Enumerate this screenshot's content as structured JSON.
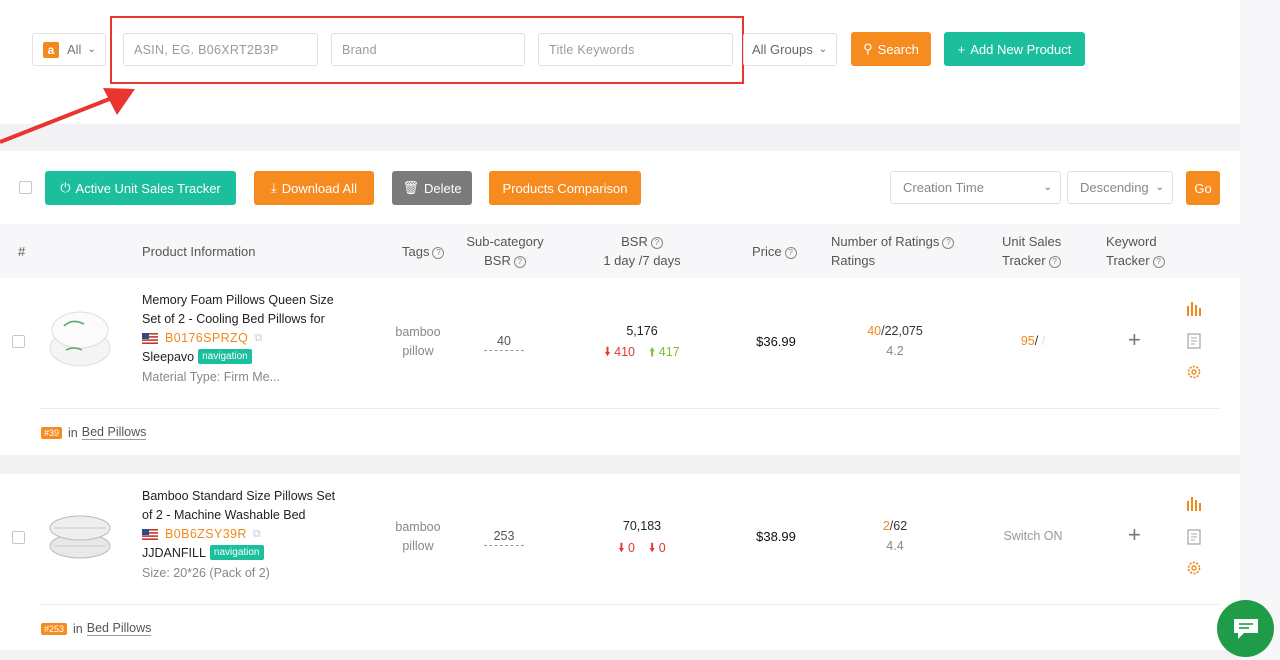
{
  "toolbar": {
    "marketplace": "All",
    "asin_placeholder": "ASIN, EG. B06XRT2B3P",
    "brand_placeholder": "Brand",
    "title_placeholder": "Title Keywords",
    "groups": "All Groups",
    "search_label": "Search",
    "add_label": "Add New Product"
  },
  "actions": {
    "active_tracker": "Active Unit Sales Tracker",
    "download_all": "Download All",
    "delete": "Delete",
    "compare": "Products Comparison",
    "sort_field": "Creation Time",
    "sort_order": "Descending",
    "go": "Go"
  },
  "columns": {
    "num": "#",
    "product": "Product Information",
    "tags": "Tags",
    "subcat_1": "Sub-category",
    "subcat_2": "BSR",
    "bsr_1": "BSR",
    "bsr_2": "1 day /7 days",
    "price": "Price",
    "ratings_1": "Number of Ratings",
    "ratings_2": "Ratings",
    "ust_1": "Unit Sales",
    "ust_2": "Tracker",
    "kt_1": "Keyword",
    "kt_2": "Tracker"
  },
  "products": [
    {
      "title_1": "Memory Foam Pillows Queen Size",
      "title_2": "Set of 2 - Cooling Bed Pillows for",
      "asin": "B0176SPRZQ",
      "brand": "Sleepavo",
      "badge": "navigation",
      "attr": "Material Type: Firm Me...",
      "tags_1": "bamboo",
      "tags_2": "pillow",
      "subcat_bsr": "40",
      "bsr": "5,176",
      "bsr_1d": "410",
      "bsr_7d": "417",
      "price": "$36.99",
      "ratings_num": "40",
      "ratings_total": "/22,075",
      "stars": "4.2",
      "ust_val": "95",
      "ust_sep": "/",
      "ust_rest": " /",
      "rank": "#39",
      "rank_in": "in",
      "category": "Bed Pillows"
    },
    {
      "title_1": "Bamboo Standard Size Pillows Set",
      "title_2": "of 2 - Machine Washable Bed",
      "asin": "B0B6ZSY39R",
      "brand": "JJDANFILL",
      "badge": "navigation",
      "attr": "Size: 20*26 (Pack of 2)",
      "tags_1": "bamboo",
      "tags_2": "pillow",
      "subcat_bsr": "253",
      "bsr": "70,183",
      "bsr_1d": "0",
      "bsr_7d": "0",
      "price": "$38.99",
      "ratings_num": "2",
      "ratings_total": "/62",
      "stars": "4.4",
      "ust_text": "Switch ON",
      "rank": "#253",
      "rank_in": "in",
      "category": "Bed Pillows"
    }
  ],
  "colors": {
    "orange": "#f68b1f",
    "teal": "#1bbf9e",
    "red": "#e8362e",
    "green": "#7dbf2e"
  }
}
